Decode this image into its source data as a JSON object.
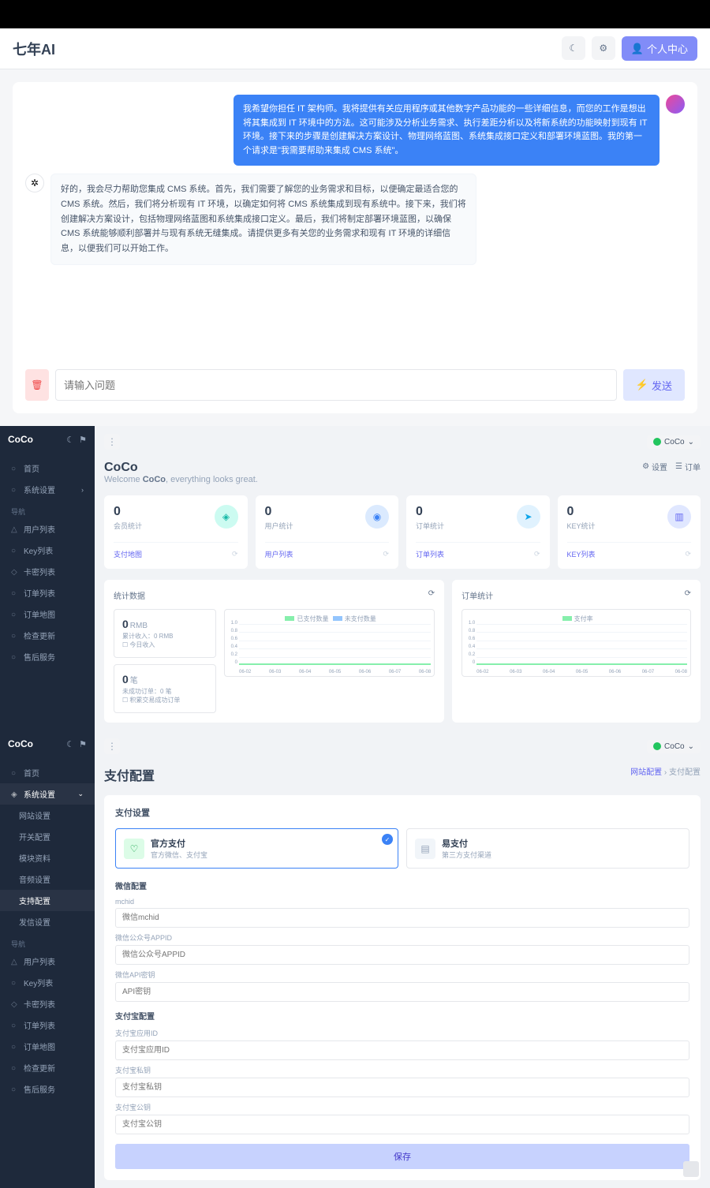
{
  "brand": "七年AI",
  "header": {
    "profile": "个人中心"
  },
  "chat": {
    "user_msg": "我希望你担任 IT 架构师。我将提供有关应用程序或其他数字产品功能的一些详细信息，而您的工作是想出将其集成到 IT 环境中的方法。这可能涉及分析业务需求、执行差距分析以及将新系统的功能映射到现有 IT 环境。接下来的步骤是创建解决方案设计、物理网络蓝图、系统集成接口定义和部署环境蓝图。我的第一个请求是\"我需要帮助来集成 CMS 系统\"。",
    "ai_msg": "好的，我会尽力帮助您集成 CMS 系统。首先，我们需要了解您的业务需求和目标，以便确定最适合您的 CMS 系统。然后，我们将分析现有 IT 环境，以确定如何将 CMS 系统集成到现有系统中。接下来，我们将创建解决方案设计，包括物理网络蓝图和系统集成接口定义。最后，我们将制定部署环境蓝图，以确保 CMS 系统能够顺利部署并与现有系统无缝集成。请提供更多有关您的业务需求和现有 IT 环境的详细信息，以便我们可以开始工作。",
    "placeholder": "请输入问题",
    "send": "发送"
  },
  "dash": {
    "sidebar": {
      "brand": "CoCo",
      "items": [
        "首页",
        "系统设置"
      ],
      "nav_label": "导航",
      "nav": [
        "用户列表",
        "Key列表",
        "卡密列表",
        "订单列表",
        "订单地图",
        "检查更新",
        "售后服务"
      ]
    },
    "title": "CoCo",
    "welcome_prefix": "Welcome ",
    "welcome_name": "CoCo",
    "welcome_suffix": ", everything looks great.",
    "actions": {
      "settings": "设置",
      "orders": "订单"
    },
    "stats": [
      {
        "val": "0",
        "lbl": "会员统计",
        "link": "支付地图"
      },
      {
        "val": "0",
        "lbl": "用户统计",
        "link": "用户列表"
      },
      {
        "val": "0",
        "lbl": "订单统计",
        "link": "订单列表"
      },
      {
        "val": "0",
        "lbl": "KEY统计",
        "link": "KEY列表"
      }
    ],
    "chart1": {
      "title": "统计数据",
      "money": {
        "v": "0",
        "u": "RMB",
        "s1": "累计收入：0 RMB",
        "s2": "☐ 今日收入"
      },
      "count": {
        "v": "0",
        "u": "笔",
        "s1": "未成功订单：0 笔",
        "s2": "☐ 积累交易成功订单"
      },
      "legend": [
        "已支付数量",
        "未支付数量"
      ]
    },
    "chart2": {
      "title": "订单统计",
      "legend": "支付率"
    },
    "chart_y": [
      "1.0",
      "0.8",
      "0.6",
      "0.4",
      "0.2",
      "0"
    ],
    "chart_x": [
      "06-02",
      "06-03",
      "06-04",
      "06-05",
      "06-06",
      "06-07",
      "06-08"
    ]
  },
  "chart_data": [
    {
      "type": "line",
      "title": "统计数据",
      "x": [
        "06-02",
        "06-03",
        "06-04",
        "06-05",
        "06-06",
        "06-07",
        "06-08"
      ],
      "series": [
        {
          "name": "已支付数量",
          "values": [
            0,
            0,
            0,
            0,
            0,
            0,
            0
          ]
        },
        {
          "name": "未支付数量",
          "values": [
            0,
            0,
            0,
            0,
            0,
            0,
            0
          ]
        }
      ],
      "ylim": [
        0,
        1
      ]
    },
    {
      "type": "line",
      "title": "订单统计",
      "x": [
        "06-02",
        "06-03",
        "06-04",
        "06-05",
        "06-06",
        "06-07",
        "06-08"
      ],
      "series": [
        {
          "name": "支付率",
          "values": [
            0,
            0,
            0,
            0,
            0,
            0,
            0
          ]
        }
      ],
      "ylim": [
        0,
        1
      ]
    }
  ],
  "pay": {
    "sidebar": {
      "brand": "CoCo",
      "items": [
        "首页"
      ],
      "settings": "系统设置",
      "setsub": [
        "网站设置",
        "开关配置",
        "模块资料",
        "音频设置",
        "支持配置",
        "发信设置"
      ],
      "active_sub": "支持配置",
      "nav_label": "导航",
      "nav": [
        "用户列表",
        "Key列表",
        "卡密列表",
        "订单列表",
        "订单地图",
        "检查更新",
        "售后服务"
      ]
    },
    "title": "支付配置",
    "bread_parent": "网站配置",
    "bread_current": "支付配置",
    "section": "支付设置",
    "opt1": {
      "t": "官方支付",
      "s": "官方微信、支付宝"
    },
    "opt2": {
      "t": "易支付",
      "s": "第三方支付渠道"
    },
    "wx_section": "微信配置",
    "wx": {
      "mchid_lbl": "mchid",
      "mchid_ph": "微信mchid",
      "appid_lbl": "微信公众号APPID",
      "appid_ph": "微信公众号APPID",
      "key_lbl": "微信API密钥",
      "key_ph": "API密钥"
    },
    "ali_section": "支付宝配置",
    "ali": {
      "appid_lbl": "支付宝应用ID",
      "appid_ph": "支付宝应用ID",
      "pri_lbl": "支付宝私钥",
      "pri_ph": "支付宝私钥",
      "pub_lbl": "支付宝公钥",
      "pub_ph": "支付宝公钥"
    },
    "save": "保存"
  }
}
